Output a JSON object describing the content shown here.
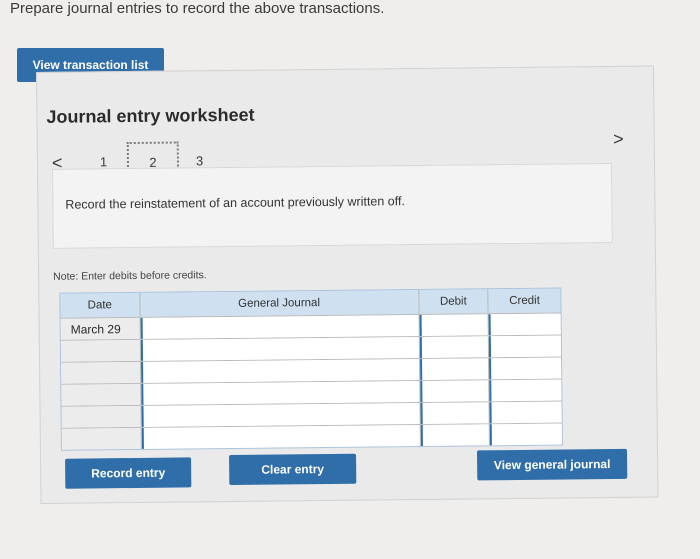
{
  "header": {
    "text": "Prepare journal entries to record the above transactions."
  },
  "buttons": {
    "view_transaction_list": "View transaction list",
    "record_entry": "Record entry",
    "clear_entry": "Clear entry",
    "view_general_journal": "View general journal"
  },
  "worksheet": {
    "title": "Journal entry worksheet",
    "nav": {
      "prev_icon": "chevron-left-icon",
      "next_icon": "chevron-right-icon",
      "prev_glyph": "<",
      "next_glyph": ">"
    },
    "steps": [
      "1",
      "2",
      "3"
    ],
    "active_step": "2",
    "description": "Record the reinstatement of an account previously written off.",
    "note": "Note: Enter debits before credits."
  },
  "table": {
    "headers": [
      "Date",
      "General Journal",
      "Debit",
      "Credit"
    ],
    "rows": [
      {
        "date": "March 29"
      },
      {
        "date": ""
      },
      {
        "date": ""
      },
      {
        "date": ""
      },
      {
        "date": ""
      },
      {
        "date": ""
      }
    ]
  }
}
